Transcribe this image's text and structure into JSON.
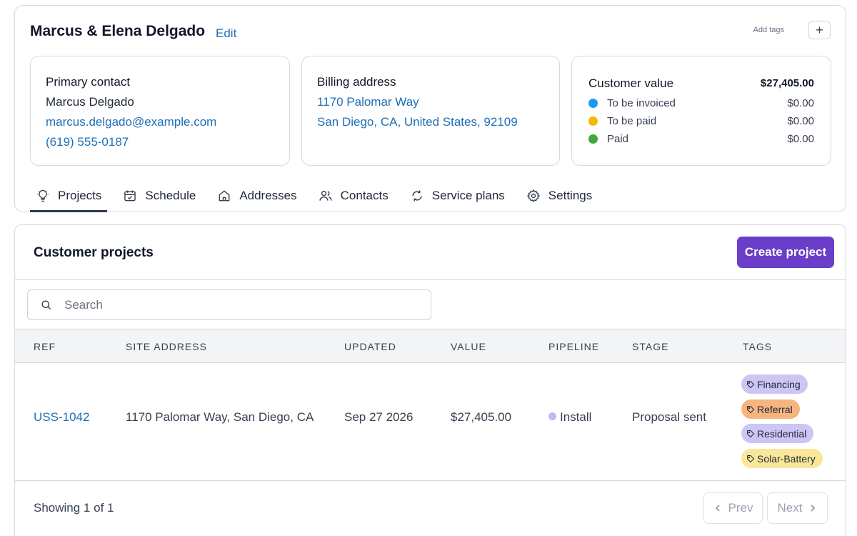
{
  "customer": {
    "name": "Marcus & Elena Delgado",
    "edit_label": "Edit",
    "add_tags_label": "Add tags",
    "add_tag_symbol": "+"
  },
  "contact": {
    "title": "Primary contact",
    "name": "Marcus Delgado",
    "email": "marcus.delgado@example.com",
    "phone": "(619) 555-0187"
  },
  "billing": {
    "title": "Billing address",
    "line1": "1170 Palomar Way",
    "line2": "San Diego, CA, United States, 92109"
  },
  "value": {
    "title": "Customer value",
    "total": "$27,405.00",
    "rows": [
      {
        "label": "To be invoiced",
        "amount": "$0.00",
        "color": "#1a9af0"
      },
      {
        "label": "To be paid",
        "amount": "$0.00",
        "color": "#f5b800"
      },
      {
        "label": "Paid",
        "amount": "$0.00",
        "color": "#43a83a"
      }
    ]
  },
  "tabs": [
    {
      "label": "Projects",
      "icon": "lightbulb-icon",
      "active": true
    },
    {
      "label": "Schedule",
      "icon": "calendar-icon",
      "active": false
    },
    {
      "label": "Addresses",
      "icon": "home-icon",
      "active": false
    },
    {
      "label": "Contacts",
      "icon": "users-icon",
      "active": false
    },
    {
      "label": "Service plans",
      "icon": "refresh-icon",
      "active": false
    },
    {
      "label": "Settings",
      "icon": "gear-icon",
      "active": false
    }
  ],
  "projects": {
    "title": "Customer projects",
    "create_label": "Create project",
    "accent_color": "#6a3ec8",
    "search_placeholder": "Search",
    "columns": [
      "REF",
      "SITE ADDRESS",
      "UPDATED",
      "VALUE",
      "PIPELINE",
      "STAGE",
      "TAGS"
    ],
    "rows": [
      {
        "ref": "USS-1042",
        "site_address": "1170 Palomar Way, San Diego, CA",
        "updated": "Sep 27 2026",
        "value": "$27,405.00",
        "pipeline": "Install",
        "stage": "Proposal sent",
        "tags": [
          {
            "label": "Financing",
            "color": "#cdc5f3"
          },
          {
            "label": "Referral",
            "color": "#f6b57f"
          },
          {
            "label": "Residential",
            "color": "#cdc5f3"
          },
          {
            "label": "Solar-Battery",
            "color": "#fbe79a"
          }
        ]
      }
    ],
    "footer_text": "Showing 1 of 1",
    "prev_label": "Prev",
    "next_label": "Next"
  }
}
